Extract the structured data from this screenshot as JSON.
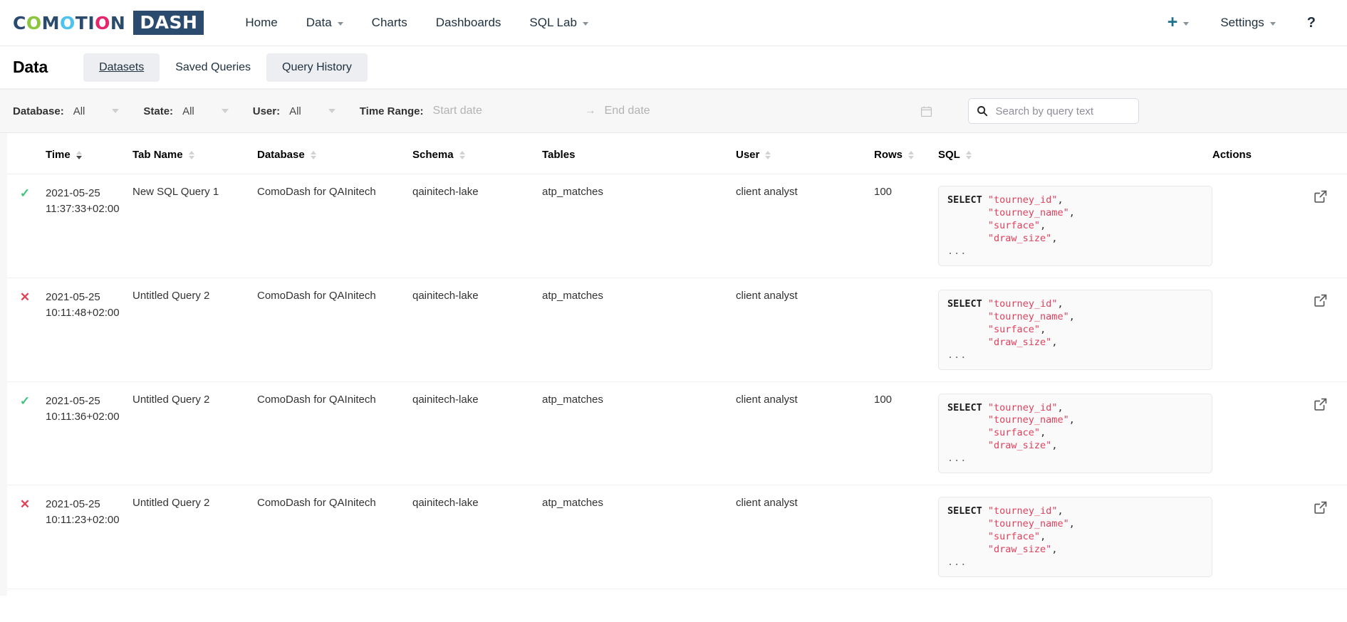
{
  "navbar": {
    "logo": {
      "letters": [
        {
          "ch": "C",
          "color": "#2a4b6e"
        },
        {
          "ch": "O",
          "color": "#8cc63f"
        },
        {
          "ch": "M",
          "color": "#2a4b6e"
        },
        {
          "ch": "O",
          "color": "#4ec3f0"
        },
        {
          "ch": "T",
          "color": "#2a4b6e"
        },
        {
          "ch": "I",
          "color": "#2a4b6e"
        },
        {
          "ch": "O",
          "color": "#e8246c"
        },
        {
          "ch": "N",
          "color": "#2a4b6e"
        }
      ],
      "badge_text": "DASH",
      "badge_bg": "#2a4b6e"
    },
    "links": [
      {
        "label": "Home",
        "has_caret": false
      },
      {
        "label": "Data",
        "has_caret": true
      },
      {
        "label": "Charts",
        "has_caret": false
      },
      {
        "label": "Dashboards",
        "has_caret": false
      },
      {
        "label": "SQL Lab",
        "has_caret": true
      }
    ],
    "right": {
      "plus_label": "+",
      "settings_label": "Settings",
      "help_label": "?",
      "accent_color": "#20728a"
    }
  },
  "subheader": {
    "title": "Data",
    "tabs": [
      {
        "label": "Datasets",
        "state": "hovered"
      },
      {
        "label": "Saved Queries",
        "state": "default"
      },
      {
        "label": "Query History",
        "state": "active"
      }
    ]
  },
  "filters": {
    "database": {
      "label": "Database:",
      "value": "All"
    },
    "state": {
      "label": "State:",
      "value": "All"
    },
    "user": {
      "label": "User:",
      "value": "All"
    },
    "time_range": {
      "label": "Time Range:",
      "start_placeholder": "Start date",
      "end_placeholder": "End date",
      "arrow": "→"
    },
    "search": {
      "placeholder": "Search by query text",
      "value": ""
    }
  },
  "table": {
    "columns": [
      {
        "key": "status",
        "label": "",
        "sortable": false
      },
      {
        "key": "time",
        "label": "Time",
        "sortable": true,
        "sort": "desc"
      },
      {
        "key": "tab_name",
        "label": "Tab Name",
        "sortable": true
      },
      {
        "key": "database",
        "label": "Database",
        "sortable": true
      },
      {
        "key": "schema",
        "label": "Schema",
        "sortable": true
      },
      {
        "key": "tables",
        "label": "Tables",
        "sortable": false
      },
      {
        "key": "user",
        "label": "User",
        "sortable": true
      },
      {
        "key": "rows",
        "label": "Rows",
        "sortable": true
      },
      {
        "key": "sql",
        "label": "SQL",
        "sortable": true
      },
      {
        "key": "actions",
        "label": "Actions",
        "sortable": false
      }
    ],
    "rows": [
      {
        "status": "success",
        "status_glyph": "✓",
        "date": "2021-05-25",
        "time": "11:37:33+02:00",
        "tab_name": "New SQL Query 1",
        "database": "ComoDash for QAInitech",
        "schema": "qainitech-lake",
        "tables": "atp_matches",
        "user": "client analyst",
        "rows": "100",
        "sql": {
          "keyword": "SELECT",
          "fields": [
            "\"tourney_id\"",
            "\"tourney_name\"",
            "\"surface\"",
            "\"draw_size\""
          ],
          "more": "..."
        },
        "action_icon": "external-link-icon"
      },
      {
        "status": "failed",
        "status_glyph": "✕",
        "date": "2021-05-25",
        "time": "10:11:48+02:00",
        "tab_name": "Untitled Query 2",
        "database": "ComoDash for QAInitech",
        "schema": "qainitech-lake",
        "tables": "atp_matches",
        "user": "client analyst",
        "rows": "",
        "sql": {
          "keyword": "SELECT",
          "fields": [
            "\"tourney_id\"",
            "\"tourney_name\"",
            "\"surface\"",
            "\"draw_size\""
          ],
          "more": "..."
        },
        "action_icon": "external-link-icon"
      },
      {
        "status": "success",
        "status_glyph": "✓",
        "date": "2021-05-25",
        "time": "10:11:36+02:00",
        "tab_name": "Untitled Query 2",
        "database": "ComoDash for QAInitech",
        "schema": "qainitech-lake",
        "tables": "atp_matches",
        "user": "client analyst",
        "rows": "100",
        "sql": {
          "keyword": "SELECT",
          "fields": [
            "\"tourney_id\"",
            "\"tourney_name\"",
            "\"surface\"",
            "\"draw_size\""
          ],
          "more": "..."
        },
        "action_icon": "external-link-icon"
      },
      {
        "status": "failed",
        "status_glyph": "✕",
        "date": "2021-05-25",
        "time": "10:11:23+02:00",
        "tab_name": "Untitled Query 2",
        "database": "ComoDash for QAInitech",
        "schema": "qainitech-lake",
        "tables": "atp_matches",
        "user": "client analyst",
        "rows": "",
        "sql": {
          "keyword": "SELECT",
          "fields": [
            "\"tourney_id\"",
            "\"tourney_name\"",
            "\"surface\"",
            "\"draw_size\""
          ],
          "more": "..."
        },
        "action_icon": "external-link-icon"
      }
    ]
  },
  "colors": {
    "success": "#3ec47b",
    "failure": "#e04355",
    "accent": "#20a7c9",
    "sql_string": "#e0405c",
    "filterbar_bg": "#f7f7f7"
  }
}
